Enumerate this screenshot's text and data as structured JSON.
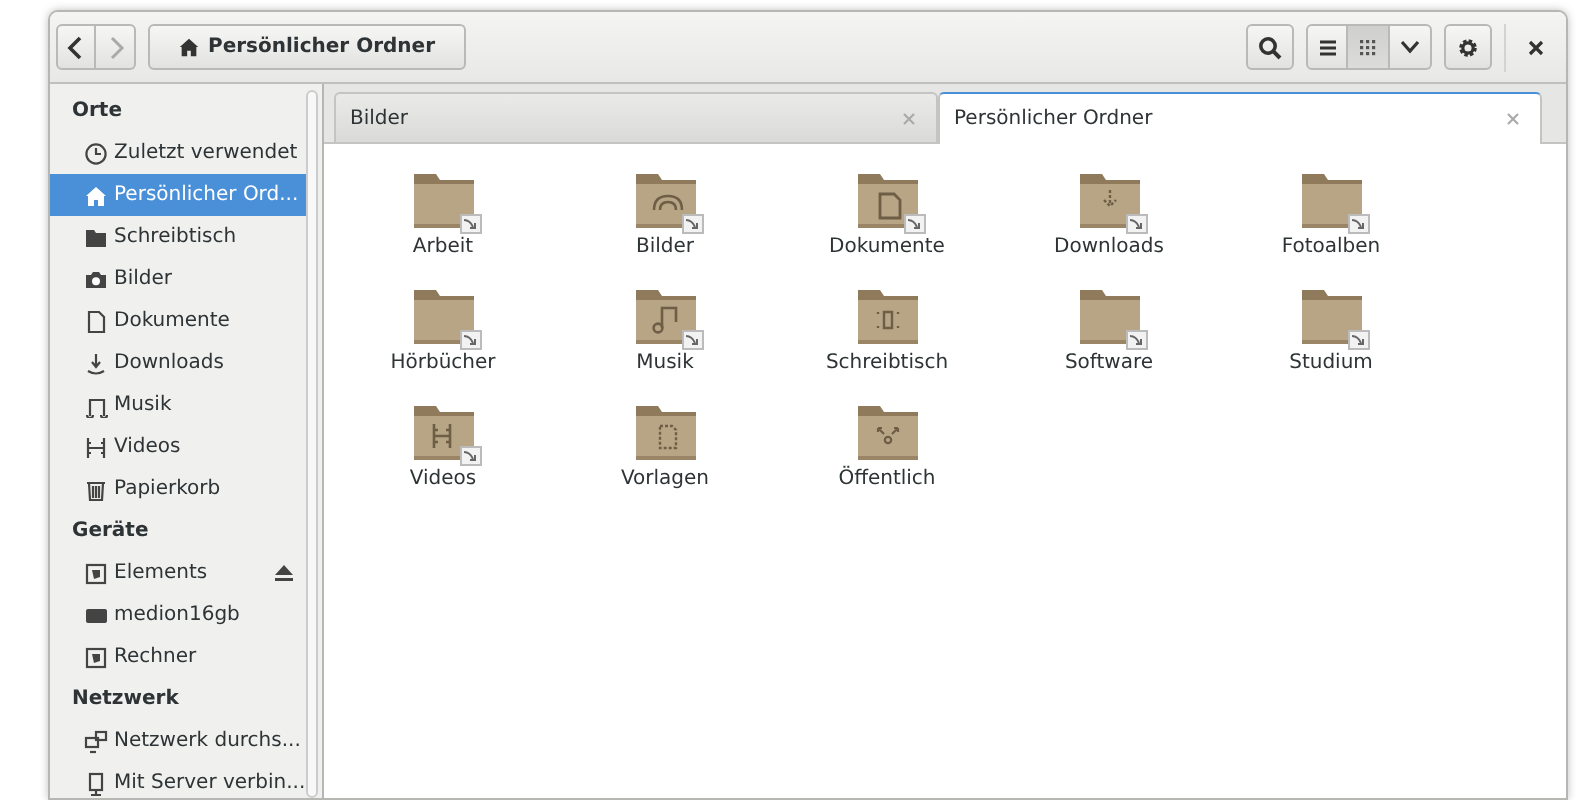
{
  "toolbar": {
    "path_button": "Persönlicher Ordner",
    "view_buttons": [
      {
        "kind": "list",
        "selected": false
      },
      {
        "kind": "grid",
        "selected": true
      }
    ]
  },
  "sidebar": {
    "sections": [
      {
        "heading": "Orte",
        "items": [
          {
            "label": "Zuletzt verwendet",
            "kind": "clock",
            "selected": false
          },
          {
            "label": "Persönlicher Ord...",
            "kind": "home",
            "selected": true
          },
          {
            "label": "Schreibtisch",
            "kind": "folder",
            "selected": false
          },
          {
            "label": "Bilder",
            "kind": "camera",
            "selected": false
          },
          {
            "label": "Dokumente",
            "kind": "document",
            "selected": false
          },
          {
            "label": "Downloads",
            "kind": "download",
            "selected": false
          },
          {
            "label": "Musik",
            "kind": "music",
            "selected": false
          },
          {
            "label": "Videos",
            "kind": "film",
            "selected": false
          },
          {
            "label": "Papierkorb",
            "kind": "trash",
            "selected": false
          }
        ]
      },
      {
        "heading": "Geräte",
        "items": [
          {
            "label": "Elements",
            "kind": "drive",
            "selected": false,
            "ejectable": true
          },
          {
            "label": "medion16gb",
            "kind": "disk",
            "selected": false,
            "ejectable": false
          },
          {
            "label": "Rechner",
            "kind": "drive",
            "selected": false,
            "ejectable": false
          }
        ]
      },
      {
        "heading": "Netzwerk",
        "items": [
          {
            "label": "Netzwerk durchs...",
            "kind": "network",
            "selected": false
          },
          {
            "label": "Mit Server verbin...",
            "kind": "server",
            "selected": false
          }
        ]
      }
    ]
  },
  "tabs": [
    {
      "label": "Bilder",
      "selected": false
    },
    {
      "label": "Persönlicher Ordner",
      "selected": true
    }
  ],
  "folders": [
    {
      "label": "Arbeit",
      "kind": "plain",
      "link": true
    },
    {
      "label": "Bilder",
      "kind": "photo",
      "link": true
    },
    {
      "label": "Dokumente",
      "kind": "document",
      "link": true
    },
    {
      "label": "Downloads",
      "kind": "download",
      "link": true
    },
    {
      "label": "Fotoalben",
      "kind": "plain",
      "link": true
    },
    {
      "label": "Hörbücher",
      "kind": "plain",
      "link": true
    },
    {
      "label": "Musik",
      "kind": "music",
      "link": true
    },
    {
      "label": "Schreibtisch",
      "kind": "desktop",
      "link": false
    },
    {
      "label": "Software",
      "kind": "plain",
      "link": true
    },
    {
      "label": "Studium",
      "kind": "plain",
      "link": true
    },
    {
      "label": "Videos",
      "kind": "video",
      "link": true
    },
    {
      "label": "Vorlagen",
      "kind": "template",
      "link": false
    },
    {
      "label": "Öffentlich",
      "kind": "public",
      "link": false
    }
  ]
}
